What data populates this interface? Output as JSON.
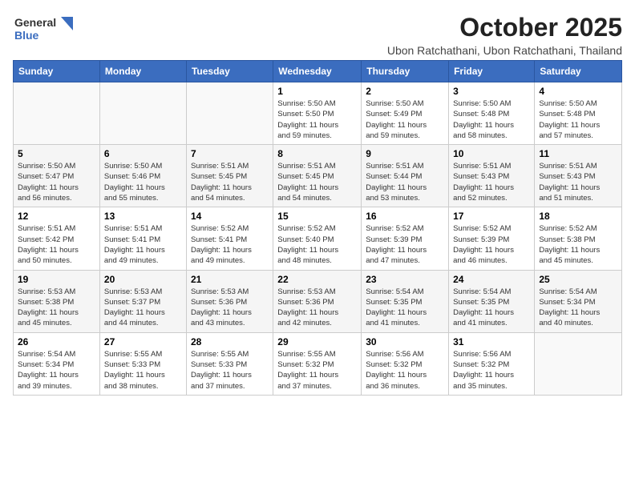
{
  "header": {
    "logo_line1": "General",
    "logo_line2": "Blue",
    "title": "October 2025",
    "subtitle": "Ubon Ratchathani, Ubon Ratchathani, Thailand"
  },
  "calendar": {
    "weekdays": [
      "Sunday",
      "Monday",
      "Tuesday",
      "Wednesday",
      "Thursday",
      "Friday",
      "Saturday"
    ],
    "weeks": [
      [
        {
          "day": "",
          "info": ""
        },
        {
          "day": "",
          "info": ""
        },
        {
          "day": "",
          "info": ""
        },
        {
          "day": "1",
          "info": "Sunrise: 5:50 AM\nSunset: 5:50 PM\nDaylight: 11 hours\nand 59 minutes."
        },
        {
          "day": "2",
          "info": "Sunrise: 5:50 AM\nSunset: 5:49 PM\nDaylight: 11 hours\nand 59 minutes."
        },
        {
          "day": "3",
          "info": "Sunrise: 5:50 AM\nSunset: 5:48 PM\nDaylight: 11 hours\nand 58 minutes."
        },
        {
          "day": "4",
          "info": "Sunrise: 5:50 AM\nSunset: 5:48 PM\nDaylight: 11 hours\nand 57 minutes."
        }
      ],
      [
        {
          "day": "5",
          "info": "Sunrise: 5:50 AM\nSunset: 5:47 PM\nDaylight: 11 hours\nand 56 minutes."
        },
        {
          "day": "6",
          "info": "Sunrise: 5:50 AM\nSunset: 5:46 PM\nDaylight: 11 hours\nand 55 minutes."
        },
        {
          "day": "7",
          "info": "Sunrise: 5:51 AM\nSunset: 5:45 PM\nDaylight: 11 hours\nand 54 minutes."
        },
        {
          "day": "8",
          "info": "Sunrise: 5:51 AM\nSunset: 5:45 PM\nDaylight: 11 hours\nand 54 minutes."
        },
        {
          "day": "9",
          "info": "Sunrise: 5:51 AM\nSunset: 5:44 PM\nDaylight: 11 hours\nand 53 minutes."
        },
        {
          "day": "10",
          "info": "Sunrise: 5:51 AM\nSunset: 5:43 PM\nDaylight: 11 hours\nand 52 minutes."
        },
        {
          "day": "11",
          "info": "Sunrise: 5:51 AM\nSunset: 5:43 PM\nDaylight: 11 hours\nand 51 minutes."
        }
      ],
      [
        {
          "day": "12",
          "info": "Sunrise: 5:51 AM\nSunset: 5:42 PM\nDaylight: 11 hours\nand 50 minutes."
        },
        {
          "day": "13",
          "info": "Sunrise: 5:51 AM\nSunset: 5:41 PM\nDaylight: 11 hours\nand 49 minutes."
        },
        {
          "day": "14",
          "info": "Sunrise: 5:52 AM\nSunset: 5:41 PM\nDaylight: 11 hours\nand 49 minutes."
        },
        {
          "day": "15",
          "info": "Sunrise: 5:52 AM\nSunset: 5:40 PM\nDaylight: 11 hours\nand 48 minutes."
        },
        {
          "day": "16",
          "info": "Sunrise: 5:52 AM\nSunset: 5:39 PM\nDaylight: 11 hours\nand 47 minutes."
        },
        {
          "day": "17",
          "info": "Sunrise: 5:52 AM\nSunset: 5:39 PM\nDaylight: 11 hours\nand 46 minutes."
        },
        {
          "day": "18",
          "info": "Sunrise: 5:52 AM\nSunset: 5:38 PM\nDaylight: 11 hours\nand 45 minutes."
        }
      ],
      [
        {
          "day": "19",
          "info": "Sunrise: 5:53 AM\nSunset: 5:38 PM\nDaylight: 11 hours\nand 45 minutes."
        },
        {
          "day": "20",
          "info": "Sunrise: 5:53 AM\nSunset: 5:37 PM\nDaylight: 11 hours\nand 44 minutes."
        },
        {
          "day": "21",
          "info": "Sunrise: 5:53 AM\nSunset: 5:36 PM\nDaylight: 11 hours\nand 43 minutes."
        },
        {
          "day": "22",
          "info": "Sunrise: 5:53 AM\nSunset: 5:36 PM\nDaylight: 11 hours\nand 42 minutes."
        },
        {
          "day": "23",
          "info": "Sunrise: 5:54 AM\nSunset: 5:35 PM\nDaylight: 11 hours\nand 41 minutes."
        },
        {
          "day": "24",
          "info": "Sunrise: 5:54 AM\nSunset: 5:35 PM\nDaylight: 11 hours\nand 41 minutes."
        },
        {
          "day": "25",
          "info": "Sunrise: 5:54 AM\nSunset: 5:34 PM\nDaylight: 11 hours\nand 40 minutes."
        }
      ],
      [
        {
          "day": "26",
          "info": "Sunrise: 5:54 AM\nSunset: 5:34 PM\nDaylight: 11 hours\nand 39 minutes."
        },
        {
          "day": "27",
          "info": "Sunrise: 5:55 AM\nSunset: 5:33 PM\nDaylight: 11 hours\nand 38 minutes."
        },
        {
          "day": "28",
          "info": "Sunrise: 5:55 AM\nSunset: 5:33 PM\nDaylight: 11 hours\nand 37 minutes."
        },
        {
          "day": "29",
          "info": "Sunrise: 5:55 AM\nSunset: 5:32 PM\nDaylight: 11 hours\nand 37 minutes."
        },
        {
          "day": "30",
          "info": "Sunrise: 5:56 AM\nSunset: 5:32 PM\nDaylight: 11 hours\nand 36 minutes."
        },
        {
          "day": "31",
          "info": "Sunrise: 5:56 AM\nSunset: 5:32 PM\nDaylight: 11 hours\nand 35 minutes."
        },
        {
          "day": "",
          "info": ""
        }
      ]
    ]
  }
}
